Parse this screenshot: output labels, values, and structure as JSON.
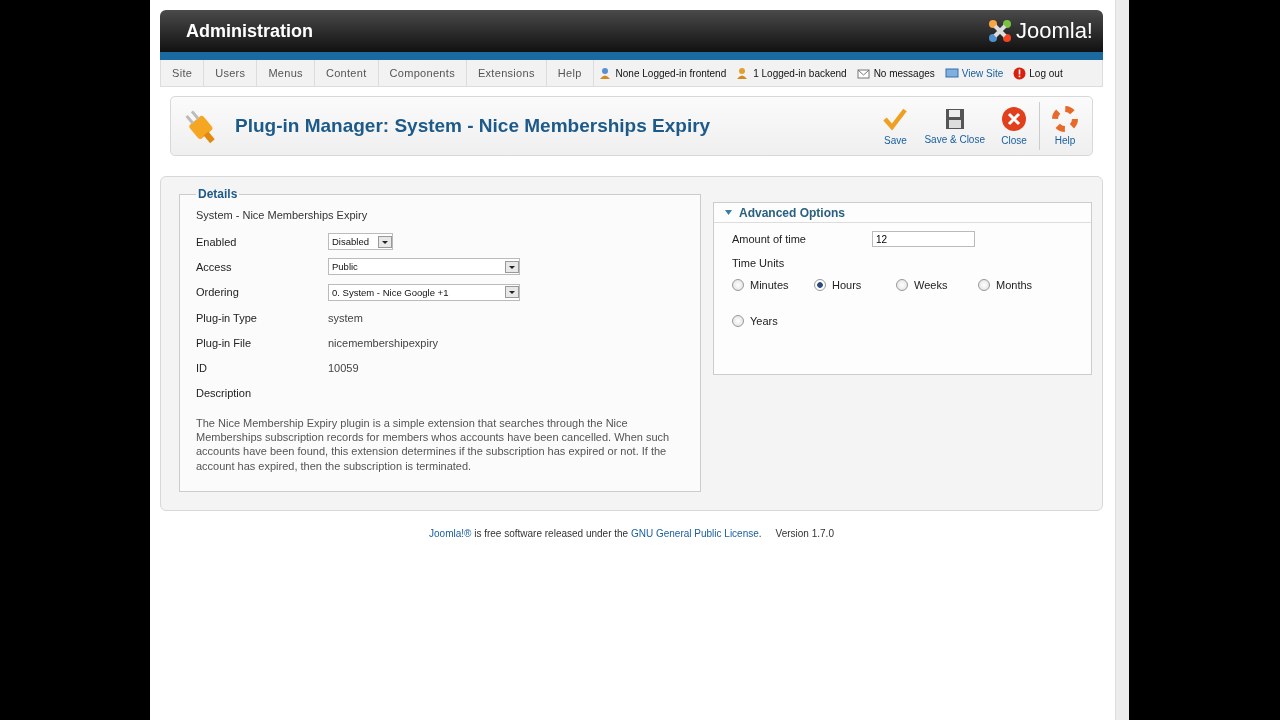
{
  "header": {
    "title": "Administration",
    "logo": "Joomla!"
  },
  "menu": [
    {
      "label": "Site"
    },
    {
      "label": "Users"
    },
    {
      "label": "Menus"
    },
    {
      "label": "Content"
    },
    {
      "label": "Components"
    },
    {
      "label": "Extensions"
    },
    {
      "label": "Help"
    }
  ],
  "status": [
    {
      "kind": "frontend",
      "label": "None Logged-in frontend"
    },
    {
      "kind": "backend",
      "label": "1 Logged-in backend"
    },
    {
      "kind": "messages",
      "label": "No messages"
    },
    {
      "kind": "viewsite",
      "label": "View Site"
    },
    {
      "kind": "logout",
      "label": "Log out"
    }
  ],
  "toolbar": {
    "title": "Plug-in Manager: System - Nice Memberships Expiry",
    "buttons": [
      {
        "kind": "save",
        "label": "Save"
      },
      {
        "kind": "saveclose",
        "label": "Save & Close"
      },
      {
        "kind": "close",
        "label": "Close"
      },
      {
        "kind": "help",
        "label": "Help"
      }
    ]
  },
  "details": {
    "legend": "Details",
    "name": "System - Nice Memberships Expiry",
    "fields": [
      {
        "kind": "toggle",
        "label": "Enabled",
        "value": "Disabled"
      },
      {
        "kind": "select",
        "label": "Access",
        "value": "Public"
      },
      {
        "kind": "select",
        "label": "Ordering",
        "value": "0. System - Nice Google +1"
      },
      {
        "kind": "text",
        "label": "Plug-in Type",
        "value": "system"
      },
      {
        "kind": "text",
        "label": "Plug-in File",
        "value": "nicemembershipexpiry"
      },
      {
        "kind": "text",
        "label": "ID",
        "value": "10059"
      },
      {
        "kind": "heading",
        "label": "Description"
      }
    ],
    "description": "The Nice Membership Expiry plugin is a simple extension that searches through the Nice Memberships subscription records for members whos accounts have been cancelled. When such accounts have been found, this extension determines if the subscription has expired or not. If the account has expired, then the subscription is terminated."
  },
  "advanced": {
    "title": "Advanced Options",
    "expanded": true,
    "amount_label": "Amount of time",
    "amount_value": "12",
    "units_label": "Time Units",
    "units": [
      {
        "label": "Minutes",
        "selected": false
      },
      {
        "label": "Hours",
        "selected": true
      },
      {
        "label": "Weeks",
        "selected": false
      },
      {
        "label": "Months",
        "selected": false
      },
      {
        "label": "Years",
        "selected": false
      }
    ]
  },
  "footer": {
    "link": "Joomla!®",
    "text": " is free software released under the ",
    "license": "GNU General Public License",
    "end": ".",
    "version": "Version 1.7.0"
  }
}
